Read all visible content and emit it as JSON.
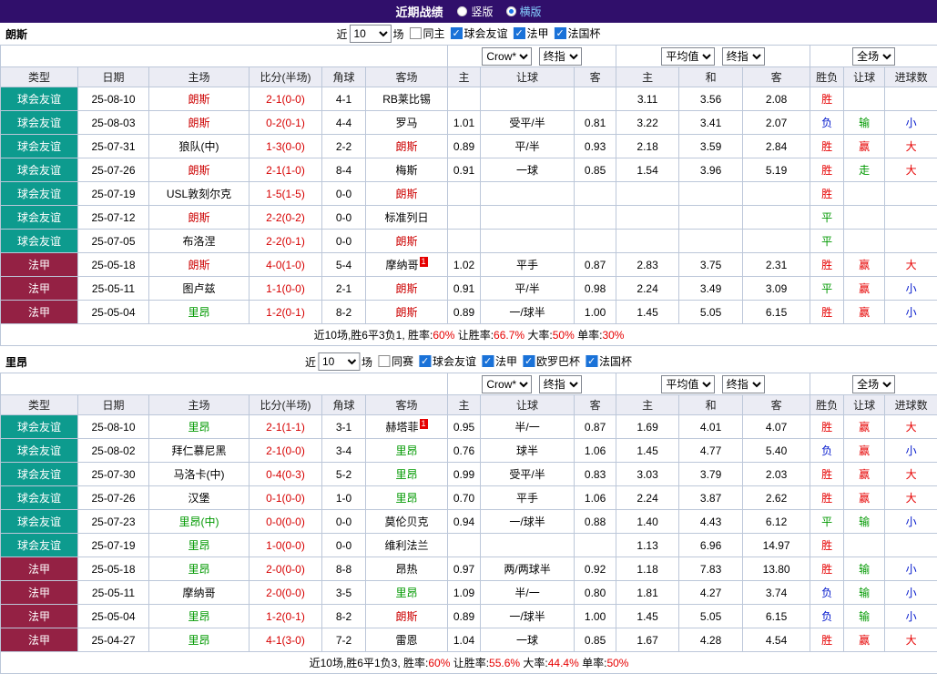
{
  "top_bar": {
    "title": "近期战绩",
    "view_options": [
      {
        "label": "竖版",
        "selected": false
      },
      {
        "label": "横版",
        "selected": true
      }
    ]
  },
  "colors": {
    "top_bar_background": "#300f6b",
    "friendly_type": "#0d9b8e",
    "ligue1_type": "#942144",
    "win": "#e60000",
    "draw": "#009900",
    "loss": "#0016cc",
    "score_text": "#d60000",
    "lens_team": "#cc0000",
    "lyon_team": "#009900",
    "checkbox_checked": "#1a72d8",
    "header_background": "#ebecf4"
  },
  "sections": [
    {
      "team": "朗斯",
      "filter": {
        "prefix": "近",
        "count": "10",
        "suffix": "场",
        "checkboxes": [
          {
            "label": "同主",
            "checked": false
          },
          {
            "label": "球会友谊",
            "checked": true
          },
          {
            "label": "法甲",
            "checked": true
          },
          {
            "label": "法国杯",
            "checked": true
          }
        ]
      },
      "selects": {
        "source": "Crow*",
        "source_type": "终指",
        "average": "平均值",
        "average_type": "终指",
        "scope": "全场"
      },
      "columns": [
        "类型",
        "日期",
        "主场",
        "比分(半场)",
        "角球",
        "客场",
        "主",
        "让球",
        "客",
        "主",
        "和",
        "客",
        "胜负",
        "让球",
        "进球数"
      ],
      "rows": [
        {
          "type": "球会友谊",
          "date": "25-08-10",
          "home": "朗斯",
          "home_badge": "",
          "score": "2-1(0-0)",
          "corner": "4-1",
          "away": "RB莱比锡",
          "away_badge": "",
          "odds": [
            "",
            "",
            ""
          ],
          "avg": [
            "3.11",
            "3.56",
            "2.08"
          ],
          "res": "胜",
          "hres": "",
          "gres": ""
        },
        {
          "type": "球会友谊",
          "date": "25-08-03",
          "home": "朗斯",
          "home_badge": "",
          "score": "0-2(0-1)",
          "corner": "4-4",
          "away": "罗马",
          "away_badge": "",
          "odds": [
            "1.01",
            "受平/半",
            "0.81"
          ],
          "avg": [
            "3.22",
            "3.41",
            "2.07"
          ],
          "res": "负",
          "hres": "输",
          "gres": "小"
        },
        {
          "type": "球会友谊",
          "date": "25-07-31",
          "home": "狼队(中)",
          "home_badge": "",
          "score": "1-3(0-0)",
          "corner": "2-2",
          "away": "朗斯",
          "away_badge": "",
          "odds": [
            "0.89",
            "平/半",
            "0.93"
          ],
          "avg": [
            "2.18",
            "3.59",
            "2.84"
          ],
          "res": "胜",
          "hres": "赢",
          "gres": "大"
        },
        {
          "type": "球会友谊",
          "date": "25-07-26",
          "home": "朗斯",
          "home_badge": "",
          "score": "2-1(1-0)",
          "corner": "8-4",
          "away": "梅斯",
          "away_badge": "",
          "odds": [
            "0.91",
            "一球",
            "0.85"
          ],
          "avg": [
            "1.54",
            "3.96",
            "5.19"
          ],
          "res": "胜",
          "hres": "走",
          "gres": "大"
        },
        {
          "type": "球会友谊",
          "date": "25-07-19",
          "home": "USL敦刻尔克",
          "home_badge": "",
          "score": "1-5(1-5)",
          "corner": "0-0",
          "away": "朗斯",
          "away_badge": "",
          "odds": [
            "",
            "",
            ""
          ],
          "avg": [
            "",
            "",
            ""
          ],
          "res": "胜",
          "hres": "",
          "gres": ""
        },
        {
          "type": "球会友谊",
          "date": "25-07-12",
          "home": "朗斯",
          "home_badge": "",
          "score": "2-2(0-2)",
          "corner": "0-0",
          "away": "标准列日",
          "away_badge": "",
          "odds": [
            "",
            "",
            ""
          ],
          "avg": [
            "",
            "",
            ""
          ],
          "res": "平",
          "hres": "",
          "gres": ""
        },
        {
          "type": "球会友谊",
          "date": "25-07-05",
          "home": "布洛涅",
          "home_badge": "",
          "score": "2-2(0-1)",
          "corner": "0-0",
          "away": "朗斯",
          "away_badge": "",
          "odds": [
            "",
            "",
            ""
          ],
          "avg": [
            "",
            "",
            ""
          ],
          "res": "平",
          "hres": "",
          "gres": ""
        },
        {
          "type": "法甲",
          "date": "25-05-18",
          "home": "朗斯",
          "home_badge": "",
          "score": "4-0(1-0)",
          "corner": "5-4",
          "away": "摩纳哥",
          "away_badge": "1",
          "odds": [
            "1.02",
            "平手",
            "0.87"
          ],
          "avg": [
            "2.83",
            "3.75",
            "2.31"
          ],
          "res": "胜",
          "hres": "赢",
          "gres": "大"
        },
        {
          "type": "法甲",
          "date": "25-05-11",
          "home": "图卢兹",
          "home_badge": "",
          "score": "1-1(0-0)",
          "corner": "2-1",
          "away": "朗斯",
          "away_badge": "",
          "odds": [
            "0.91",
            "平/半",
            "0.98"
          ],
          "avg": [
            "2.24",
            "3.49",
            "3.09"
          ],
          "res": "平",
          "hres": "赢",
          "gres": "小"
        },
        {
          "type": "法甲",
          "date": "25-05-04",
          "home": "里昂",
          "home_badge": "",
          "score": "1-2(0-1)",
          "corner": "8-2",
          "away": "朗斯",
          "away_badge": "",
          "odds": [
            "0.89",
            "一/球半",
            "1.00"
          ],
          "avg": [
            "1.45",
            "5.05",
            "6.15"
          ],
          "res": "胜",
          "hres": "赢",
          "gres": "小"
        }
      ],
      "summary": {
        "prefix": "近10场,胜6平3负1,",
        "stats": [
          {
            "label": "胜率:",
            "value": "60%"
          },
          {
            "label": "让胜率:",
            "value": "66.7%"
          },
          {
            "label": "大率:",
            "value": "50%"
          },
          {
            "label": "单率:",
            "value": "30%"
          }
        ]
      }
    },
    {
      "team": "里昂",
      "filter": {
        "prefix": "近",
        "count": "10",
        "suffix": "场",
        "checkboxes": [
          {
            "label": "同赛",
            "checked": false
          },
          {
            "label": "球会友谊",
            "checked": true
          },
          {
            "label": "法甲",
            "checked": true
          },
          {
            "label": "欧罗巴杯",
            "checked": true
          },
          {
            "label": "法国杯",
            "checked": true
          }
        ]
      },
      "selects": {
        "source": "Crow*",
        "source_type": "终指",
        "average": "平均值",
        "average_type": "终指",
        "scope": "全场"
      },
      "columns": [
        "类型",
        "日期",
        "主场",
        "比分(半场)",
        "角球",
        "客场",
        "主",
        "让球",
        "客",
        "主",
        "和",
        "客",
        "胜负",
        "让球",
        "进球数"
      ],
      "rows": [
        {
          "type": "球会友谊",
          "date": "25-08-10",
          "home": "里昂",
          "home_badge": "",
          "score": "2-1(1-1)",
          "corner": "3-1",
          "away": "赫塔菲",
          "away_badge": "1",
          "odds": [
            "0.95",
            "半/一",
            "0.87"
          ],
          "avg": [
            "1.69",
            "4.01",
            "4.07"
          ],
          "res": "胜",
          "hres": "赢",
          "gres": "大"
        },
        {
          "type": "球会友谊",
          "date": "25-08-02",
          "home": "拜仁慕尼黑",
          "home_badge": "",
          "score": "2-1(0-0)",
          "corner": "3-4",
          "away": "里昂",
          "away_badge": "",
          "odds": [
            "0.76",
            "球半",
            "1.06"
          ],
          "avg": [
            "1.45",
            "4.77",
            "5.40"
          ],
          "res": "负",
          "hres": "赢",
          "gres": "小"
        },
        {
          "type": "球会友谊",
          "date": "25-07-30",
          "home": "马洛卡(中)",
          "home_badge": "",
          "score": "0-4(0-3)",
          "corner": "5-2",
          "away": "里昂",
          "away_badge": "",
          "odds": [
            "0.99",
            "受平/半",
            "0.83"
          ],
          "avg": [
            "3.03",
            "3.79",
            "2.03"
          ],
          "res": "胜",
          "hres": "赢",
          "gres": "大"
        },
        {
          "type": "球会友谊",
          "date": "25-07-26",
          "home": "汉堡",
          "home_badge": "",
          "score": "0-1(0-0)",
          "corner": "1-0",
          "away": "里昂",
          "away_badge": "",
          "odds": [
            "0.70",
            "平手",
            "1.06"
          ],
          "avg": [
            "2.24",
            "3.87",
            "2.62"
          ],
          "res": "胜",
          "hres": "赢",
          "gres": "大"
        },
        {
          "type": "球会友谊",
          "date": "25-07-23",
          "home": "里昂(中)",
          "home_badge": "",
          "score": "0-0(0-0)",
          "corner": "0-0",
          "away": "莫伦贝克",
          "away_badge": "",
          "odds": [
            "0.94",
            "一/球半",
            "0.88"
          ],
          "avg": [
            "1.40",
            "4.43",
            "6.12"
          ],
          "res": "平",
          "hres": "输",
          "gres": "小"
        },
        {
          "type": "球会友谊",
          "date": "25-07-19",
          "home": "里昂",
          "home_badge": "",
          "score": "1-0(0-0)",
          "corner": "0-0",
          "away": "维利法兰",
          "away_badge": "",
          "odds": [
            "",
            "",
            ""
          ],
          "avg": [
            "1.13",
            "6.96",
            "14.97"
          ],
          "res": "胜",
          "hres": "",
          "gres": ""
        },
        {
          "type": "法甲",
          "date": "25-05-18",
          "home": "里昂",
          "home_badge": "",
          "score": "2-0(0-0)",
          "corner": "8-8",
          "away": "昂热",
          "away_badge": "",
          "odds": [
            "0.97",
            "两/两球半",
            "0.92"
          ],
          "avg": [
            "1.18",
            "7.83",
            "13.80"
          ],
          "res": "胜",
          "hres": "输",
          "gres": "小"
        },
        {
          "type": "法甲",
          "date": "25-05-11",
          "home": "摩纳哥",
          "home_badge": "",
          "score": "2-0(0-0)",
          "corner": "3-5",
          "away": "里昂",
          "away_badge": "",
          "odds": [
            "1.09",
            "半/一",
            "0.80"
          ],
          "avg": [
            "1.81",
            "4.27",
            "3.74"
          ],
          "res": "负",
          "hres": "输",
          "gres": "小"
        },
        {
          "type": "法甲",
          "date": "25-05-04",
          "home": "里昂",
          "home_badge": "",
          "score": "1-2(0-1)",
          "corner": "8-2",
          "away": "朗斯",
          "away_badge": "",
          "odds": [
            "0.89",
            "一/球半",
            "1.00"
          ],
          "avg": [
            "1.45",
            "5.05",
            "6.15"
          ],
          "res": "负",
          "hres": "输",
          "gres": "小"
        },
        {
          "type": "法甲",
          "date": "25-04-27",
          "home": "里昂",
          "home_badge": "",
          "score": "4-1(3-0)",
          "corner": "7-2",
          "away": "雷恩",
          "away_badge": "",
          "odds": [
            "1.04",
            "一球",
            "0.85"
          ],
          "avg": [
            "1.67",
            "4.28",
            "4.54"
          ],
          "res": "胜",
          "hres": "赢",
          "gres": "大"
        }
      ],
      "summary": {
        "prefix": "近10场,胜6平1负3,",
        "stats": [
          {
            "label": "胜率:",
            "value": "60%"
          },
          {
            "label": "让胜率:",
            "value": "55.6%"
          },
          {
            "label": "大率:",
            "value": "44.4%"
          },
          {
            "label": "单率:",
            "value": "50%"
          }
        ]
      }
    }
  ]
}
